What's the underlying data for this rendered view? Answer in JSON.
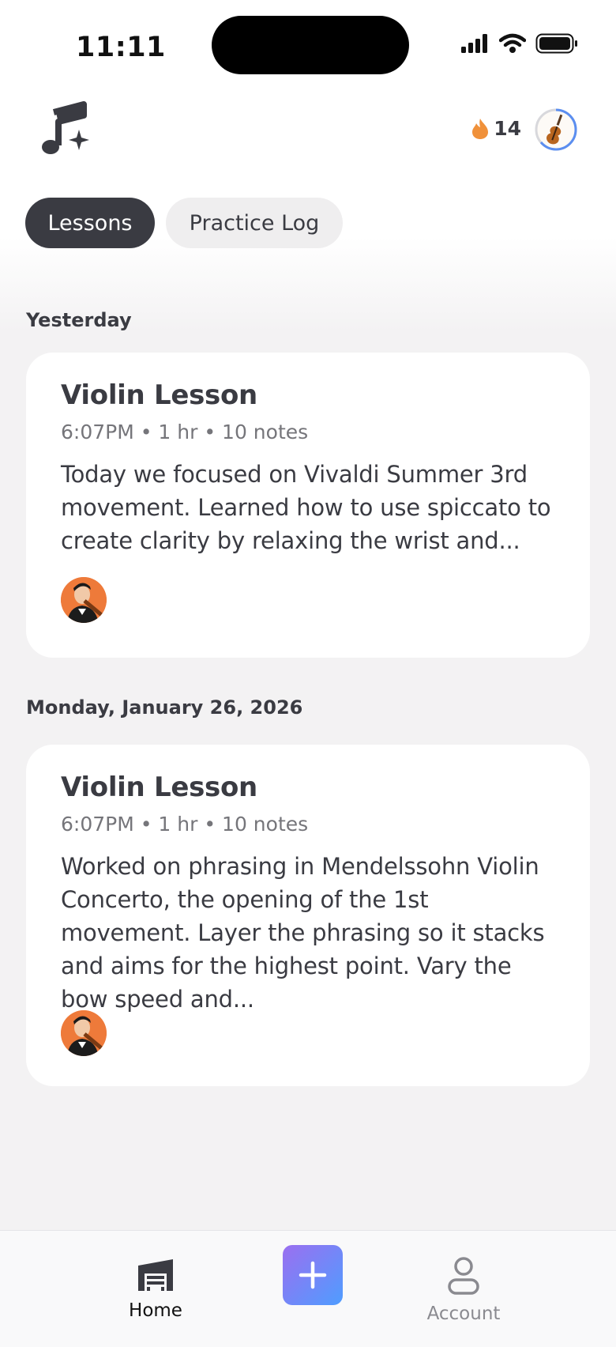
{
  "status_bar": {
    "time": "11:11"
  },
  "header": {
    "streak_count": "14"
  },
  "tabs": [
    {
      "label": "Lessons",
      "active": true
    },
    {
      "label": "Practice Log",
      "active": false
    }
  ],
  "sections": [
    {
      "date_label": "Yesterday",
      "card": {
        "title": "Violin Lesson",
        "meta": "6:07PM • 1 hr • 10 notes",
        "body": "Today we focused on Vivaldi Summer 3rd movement. Learned how to use spiccato to create clarity by relaxing the wrist and..."
      }
    },
    {
      "date_label": "Monday, January 26, 2026",
      "card": {
        "title": "Violin Lesson",
        "meta": "6:07PM • 1 hr • 10 notes",
        "body": "Worked on phrasing in Mendelssohn Violin Concerto, the opening of the 1st movement. Layer the phrasing so it stacks and aims for the highest point. Vary the bow speed and..."
      }
    }
  ],
  "bottom_nav": {
    "home_label": "Home",
    "account_label": "Account"
  },
  "colors": {
    "accent_dark": "#3a3b42",
    "streak_flame": "#f0913a",
    "add_gradient_start": "#9b6ff0",
    "add_gradient_end": "#4f9dff",
    "avatar_bg": "#ee7a3a"
  },
  "icons": [
    "music-note-sparkle-icon",
    "flame-icon",
    "violin-icon",
    "home-icon",
    "plus-icon",
    "person-icon",
    "signal-icon",
    "wifi-icon",
    "battery-icon"
  ]
}
